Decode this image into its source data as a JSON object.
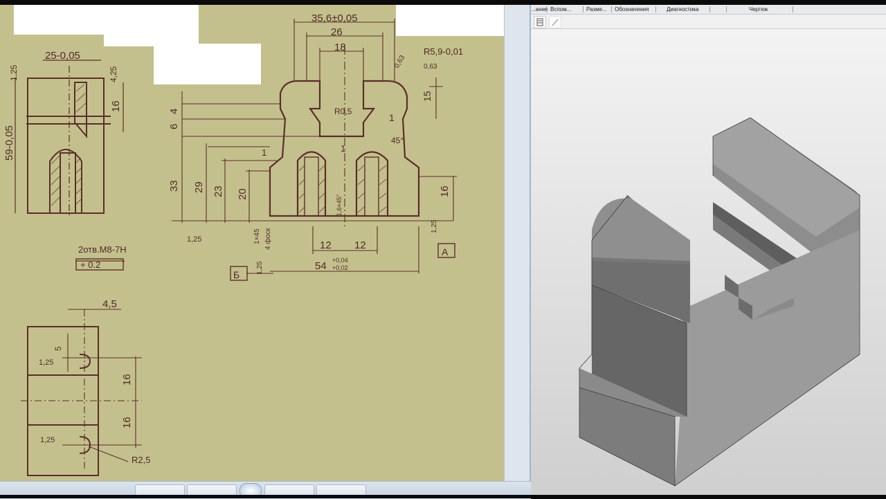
{
  "cad": {
    "tabs": [
      "...ание",
      "Вспом...",
      "Разме...",
      "Обозначения",
      "Диагностика",
      "Чертеж"
    ],
    "toolbar": {
      "icons": [
        "properties-icon",
        "edit-pen-icon"
      ]
    }
  },
  "drawing": {
    "dims": {
      "d_35_6": "35,6±0,05",
      "d_26": "26",
      "d_18": "18",
      "d_25": "25-0,05",
      "d_r5_9": "R5,9-0,01",
      "d_063a": "0,63",
      "d_063b": "0,63",
      "d_15": "15",
      "d_1_25a": "1,25",
      "d_4_25": "4,25",
      "d_16a": "16",
      "d_59": "59-0,05",
      "d_4": "4",
      "d_6": "6",
      "d_r05": "R0,5",
      "d_1a": "1",
      "d_45deg": "45°",
      "d_1b": "1",
      "d_1c": "1",
      "d_33": "33",
      "d_29": "29",
      "d_23": "23",
      "d_20": "20",
      "d_16b": "16",
      "d_chamfer": "1,6×45°",
      "d_1_25b": "1,25",
      "d_1_25c": "1,25",
      "d_1x45": "1×45",
      "d_4ots": "4 фоск",
      "d_12a": "12",
      "d_12b": "12",
      "d_54": "54",
      "d_54_tol_up": "+0,04",
      "d_54_tol_dn": "+0,02",
      "d_1_25d": "1,25",
      "d_m8": "2отв.М8-7Н",
      "d_tol": "+ 0.2",
      "d_4_5": "4,5",
      "d_5": "5",
      "d_1_25e": "1,25",
      "d_16c": "16",
      "d_16d": "16",
      "d_1_25f": "1,25",
      "d_r2_5": "R2,5",
      "base_a": "А",
      "base_b": "Б"
    }
  }
}
